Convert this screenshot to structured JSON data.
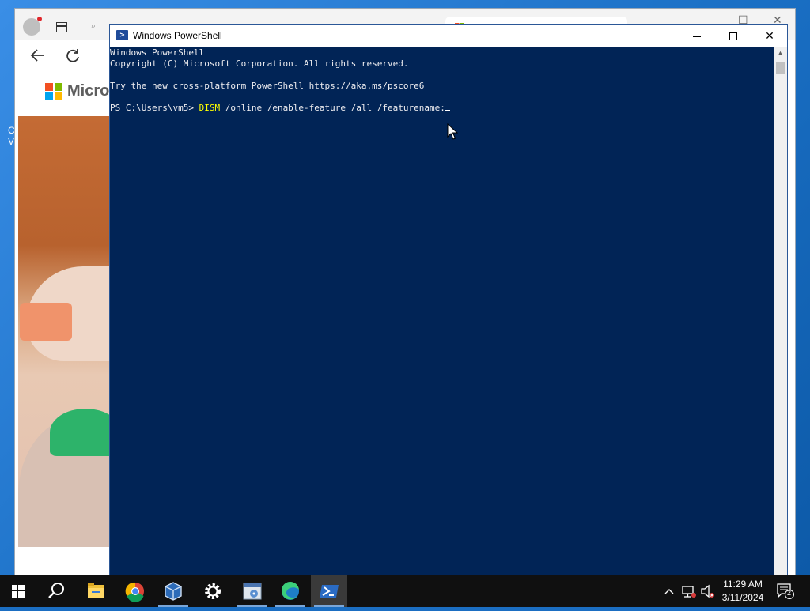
{
  "desktop": {
    "icon_fragments": [
      "C",
      "V"
    ]
  },
  "edge": {
    "brand_word": "Micros",
    "search_glyph": "⌕"
  },
  "powershell": {
    "title": "Windows PowerShell",
    "lines": [
      "Windows PowerShell",
      "Copyright (C) Microsoft Corporation. All rights reserved.",
      "",
      "Try the new cross-platform PowerShell https://aka.ms/pscore6",
      ""
    ],
    "prompt": "PS C:\\Users\\vm5> ",
    "command_name": "DISM",
    "command_args": " /online /enable-feature /all /featurename:"
  },
  "taskbar": {
    "items": [
      "start",
      "search",
      "file-explorer",
      "chrome",
      "virtualbox",
      "settings",
      "disk-tool",
      "edge",
      "powershell"
    ],
    "active": "powershell",
    "time": "11:29 AM",
    "date": "3/11/2024",
    "notification_count": "2"
  }
}
